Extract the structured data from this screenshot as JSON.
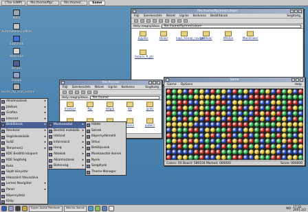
{
  "taskbar": {
    "buttons": [
      {
        "label": "(The GIMP)",
        "active": false
      },
      {
        "label": "file:/home/ftp/...",
        "active": false
      },
      {
        "label": "file:/home/...",
        "active": false
      },
      {
        "label": "Same",
        "active": true
      }
    ]
  },
  "desktop_icons": [
    {
      "label": "Kuka",
      "color": "#9aa7b5"
    },
    {
      "label": "Automatikus indítás",
      "color": "#c5c5c5"
    },
    {
      "label": "Sablonok",
      "color": "#3f6fd0"
    },
    {
      "label": "Webcape",
      "color": "#d6d6d6"
    },
    {
      "label": "Printer",
      "color": "#4e5e8e"
    },
    {
      "label": "Floppy",
      "color": "#8fa2c5"
    },
    {
      "label": "Home_ftp_mnt_kdrom",
      "color": "#b4b4b4"
    }
  ],
  "window1": {
    "title": "file:/home/ftp/mnt/cdrom",
    "menu": [
      "Fájl",
      "Szerkesztés",
      "Nézet",
      "Ugrás",
      "Kedvenc",
      "Beállítások"
    ],
    "help": "Segítség",
    "location_label": "Hely megnyitása:",
    "location_value": "file:/home/ftp/mnt/cdrom",
    "folders": [
      "Egyéb/",
      "Hírek/",
      "logo_hónap_rovigo/",
      "Jatékok/",
      "Média/",
      "Mandrake/",
      "Solaris_fi_pt/"
    ]
  },
  "window2": {
    "title": "file:/home/",
    "menu": [
      "Fájl",
      "Szerkesztés",
      "Nézet",
      "Ugrás",
      "Kedvenc"
    ],
    "help": "Segítség",
    "location_label": "Hely megnyitása:",
    "location_value": "file:/home/",
    "folders": [
      "frankie/",
      "ftp/",
      "httpd/",
      "itt/",
      "joint/",
      "log/",
      "lost+found/",
      "mini/",
      "moni/",
      "public/"
    ]
  },
  "game": {
    "title": "Same",
    "menu": [
      "Game",
      "Options"
    ],
    "help": "Help",
    "status": "Colors: XX Board: 589104 Marked: 000000",
    "score": "Score: 000000",
    "colors": [
      "#cc2b22",
      "#2b4fcc",
      "#e2c22b",
      "#2bb44a"
    ]
  },
  "startmenu": {
    "items": [
      {
        "label": "Alkalmazások",
        "sub": true
      },
      {
        "label": "Játékok",
        "sub": true
      },
      {
        "label": "Grafika",
        "sub": true
      },
      {
        "label": "Internet",
        "sub": true
      },
      {
        "label": "Beállítások",
        "sub": true,
        "highlight": true
      },
      {
        "label": "Rendszer",
        "sub": true
      },
      {
        "label": "Segédeszközök",
        "sub": true
      },
      {
        "label": "SuSE",
        "sub": true
      },
      {
        "label": "Témamenü",
        "sub": true
      },
      {
        "label": "KDE Beállító központ",
        "sub": false
      },
      {
        "label": "KDE Segítség",
        "sub": false
      },
      {
        "label": "Kuka",
        "sub": false
      },
      {
        "label": "Saját könyvtár",
        "sub": false
      },
      {
        "label": "Hibaszűrő fókuszálva",
        "sub": false
      },
      {
        "label": "Lemez Navigátor",
        "sub": true
      },
      {
        "label": "Panel",
        "sub": true
      },
      {
        "label": "Képernyőzár",
        "sub": false
      },
      {
        "label": "Kilép",
        "sub": false
      }
    ],
    "sub1": [
      {
        "label": "Munkaasztal",
        "highlight": true
      },
      {
        "label": "Beviteli eszközök"
      },
      {
        "label": "Hálózat"
      },
      {
        "label": "Információ"
      },
      {
        "label": "Hang"
      },
      {
        "label": "Ablakok"
      },
      {
        "label": "Alkalmazások"
      },
      {
        "label": "Biztonság"
      }
    ],
    "sub2": [
      {
        "label": "Háttér"
      },
      {
        "label": "Színek"
      },
      {
        "label": "Képernyőkímélő"
      },
      {
        "label": "Stílus"
      },
      {
        "label": "Betűtípusok"
      },
      {
        "label": "Munkaasztal ikonok"
      },
      {
        "label": "Nyelv"
      },
      {
        "label": "Szegélyek"
      },
      {
        "label": "Theme Manager"
      }
    ]
  },
  "bottom_panel": {
    "boxes": [
      "Egyes Asztal Rendszer",
      "Mácma ikonok"
    ],
    "clock": "17:32",
    "date": "2001.2/2",
    "indicator": "NO"
  }
}
